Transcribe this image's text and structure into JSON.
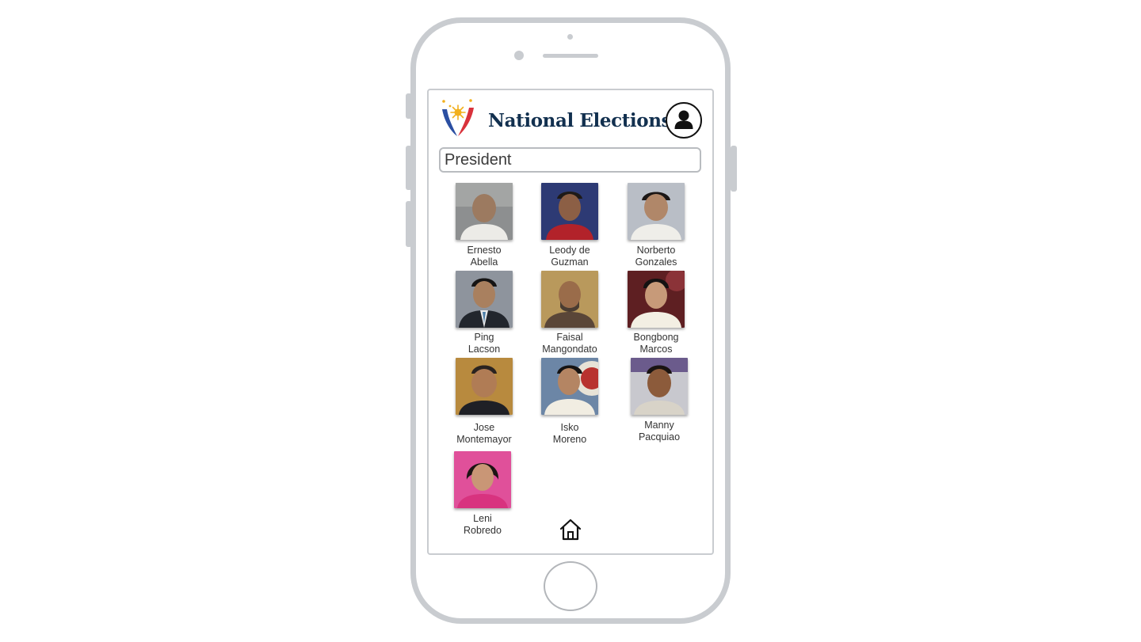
{
  "app": {
    "title": "National Elections"
  },
  "position_field": {
    "value": "President"
  },
  "candidates": [
    {
      "first": "Ernesto",
      "last": "Abella"
    },
    {
      "first": "Leody de",
      "last": "Guzman"
    },
    {
      "first": "Norberto",
      "last": "Gonzales"
    },
    {
      "first": "Ping",
      "last": "Lacson"
    },
    {
      "first": "Faisal",
      "last": "Mangondato"
    },
    {
      "first": "Bongbong",
      "last": "Marcos"
    },
    {
      "first": "Jose",
      "last": "Montemayor"
    },
    {
      "first": "Isko",
      "last": "Moreno"
    },
    {
      "first": "Manny",
      "last": "Pacquiao"
    },
    {
      "first": "Leni",
      "last": "Robredo"
    }
  ],
  "icons": {
    "logo": "election-logo-icon",
    "profile": "user-profile-icon",
    "home": "home-icon"
  },
  "colors": {
    "title": "#12304f",
    "logo_red": "#d9323b",
    "logo_blue": "#2b4fa2",
    "logo_gold": "#f2b01e",
    "phone_frame": "#c9ccd0"
  }
}
